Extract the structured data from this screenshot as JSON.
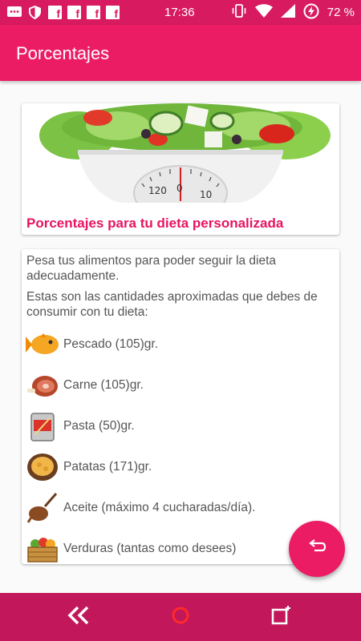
{
  "status_bar": {
    "time": "17:36",
    "battery_percent": "72 %",
    "icons": [
      "messages-icon",
      "shield-icon",
      "facebook-icon",
      "facebook-icon",
      "facebook-icon",
      "facebook-icon",
      "vibrate-icon",
      "wifi-icon",
      "signal-icon",
      "battery-charging-icon"
    ]
  },
  "app_bar": {
    "title": "Porcentajes"
  },
  "header_card": {
    "image": "salad-scale-image",
    "title": "Porcentajes para tu dieta personalizada"
  },
  "content_card": {
    "intro": "Pesa tus alimentos para poder seguir la dieta adecuadamente.",
    "subintro": "Estas son las cantidades aproximadas que debes de consumir con tu dieta:",
    "foods": [
      {
        "icon": "fish-icon",
        "label": "Pescado (105)gr."
      },
      {
        "icon": "meat-icon",
        "label": "Carne (105)gr."
      },
      {
        "icon": "pasta-icon",
        "label": "Pasta (50)gr."
      },
      {
        "icon": "potato-icon",
        "label": "Patatas (171)gr."
      },
      {
        "icon": "oil-icon",
        "label": "Aceite (máximo 4 cucharadas/día)."
      },
      {
        "icon": "vegetables-icon",
        "label": "Verduras (tantas como desees)"
      }
    ]
  },
  "fab": {
    "icon": "undo-icon"
  },
  "nav_bar": {
    "buttons": [
      "back-icon",
      "home-icon",
      "recents-icon"
    ]
  },
  "colors": {
    "primary": "#ec1c64",
    "primary_dark": "#d81b60",
    "nav": "#c2185b",
    "accent_text": "#e6135f"
  }
}
